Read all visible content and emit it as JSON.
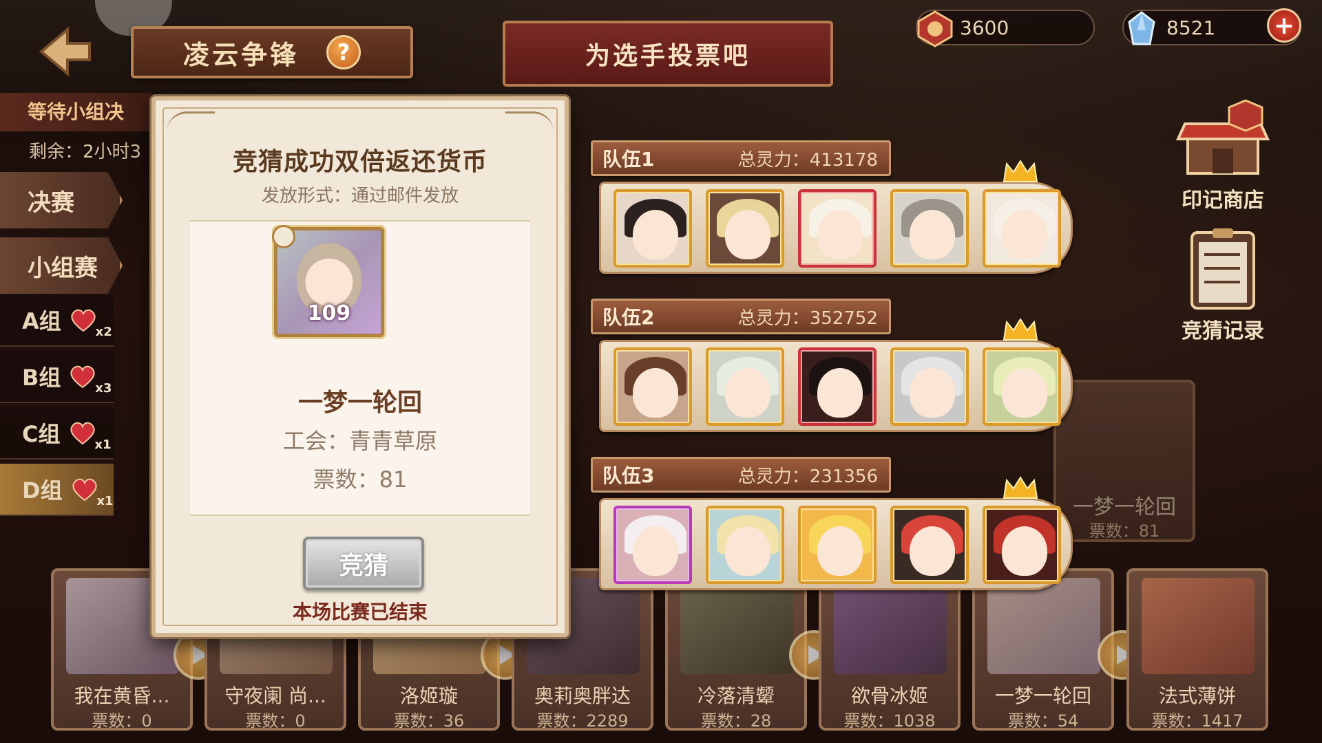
{
  "header": {
    "title": "凌云争锋",
    "vote_banner": "为选手投票吧"
  },
  "currency": {
    "coin": "3600",
    "gem": "8521"
  },
  "left_panel": {
    "stage_status": "等待小组决",
    "remaining": "剩余：2小时3",
    "tab_final": "决赛",
    "tab_group": "小组赛",
    "groups": [
      {
        "label": "A组",
        "hearts": "x2"
      },
      {
        "label": "B组",
        "hearts": "x3"
      },
      {
        "label": "C组",
        "hearts": "x1"
      },
      {
        "label": "D组",
        "hearts": "x1"
      }
    ]
  },
  "right_panel": {
    "shop_label": "印记商店",
    "record_label": "竞猜记录"
  },
  "modal": {
    "title": "竞猜成功双倍返还货币",
    "subtitle": "发放形式：通过邮件发放",
    "level": "109",
    "player_name": "一梦一轮回",
    "guild": "工会：青青草原",
    "votes": "票数：81",
    "guess_button": "竞猜",
    "ended_text": "本场比赛已结束"
  },
  "teams": [
    {
      "name": "队伍1",
      "power": "总灵力：413178"
    },
    {
      "name": "队伍2",
      "power": "总灵力：352752"
    },
    {
      "name": "队伍3",
      "power": "总灵力：231356"
    }
  ],
  "background_card": {
    "name": "一梦一轮回",
    "votes": "票数：81"
  },
  "bottom_cards": [
    {
      "name": "我在黄昏...",
      "votes": "票数：0"
    },
    {
      "name": "守夜阑 尚...",
      "votes": "票数：0"
    },
    {
      "name": "洛姬璇",
      "votes": "票数：36"
    },
    {
      "name": "奥莉奥胖达",
      "votes": "票数：2289"
    },
    {
      "name": "冷落清颦",
      "votes": "票数：28"
    },
    {
      "name": "欲骨冰姬",
      "votes": "票数：1038"
    },
    {
      "name": "一梦一轮回",
      "votes": "票数：54"
    },
    {
      "name": "法式薄饼",
      "votes": "票数：1417"
    }
  ]
}
